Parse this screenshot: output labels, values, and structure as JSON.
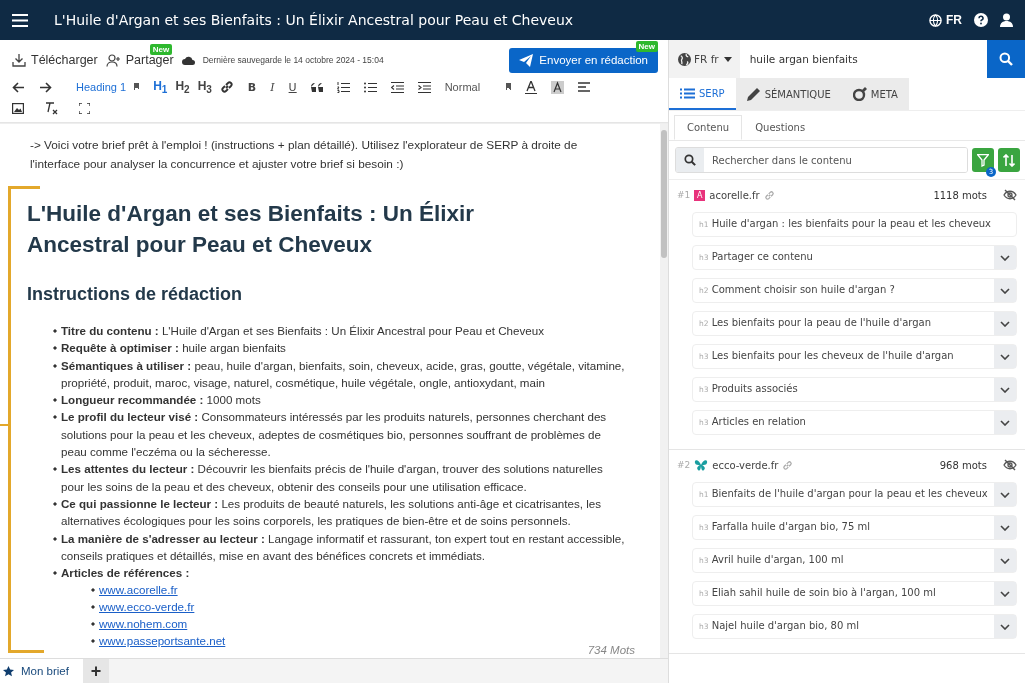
{
  "header": {
    "title": "L'Huile d'Argan et ses Bienfaits : Un Élixir Ancestral pour Peau et Cheveux",
    "language": "FR"
  },
  "actions": {
    "download": "Télécharger",
    "share": "Partager",
    "share_badge": "New",
    "saved": "Dernière sauvegarde le 14 octobre 2024 - 15:04",
    "send": "Envoyer en rédaction",
    "send_badge": "New"
  },
  "toolbar": {
    "heading_select": "Heading 1",
    "headings": [
      {
        "label": "H$_{1}$",
        "selected": true
      },
      {
        "label": "H$_{2}$",
        "selected": false
      },
      {
        "label": "H$_{3}$",
        "selected": false
      }
    ],
    "formats": [
      "B",
      "I",
      "U"
    ],
    "size_select": "Normal"
  },
  "brief": {
    "intro": "-> Voici votre brief prêt à l'emploi ! (instructions + plan détaillé). Utilisez l'explorateur de SERP à droite de l'interface pour analyser la concurrence et ajuster votre brief si besoin :)",
    "title": "L'Huile d'Argan et ses Bienfaits : Un Élixir Ancestral pour Peau et Cheveux",
    "subtitle": "Instructions de rédaction",
    "items": [
      {
        "label": "Titre du contenu :",
        "text": "L'Huile d'Argan et ses Bienfaits : Un Élixir Ancestral pour Peau et Cheveux"
      },
      {
        "label": "Requête à optimiser :",
        "text": "huile argan bienfaits"
      },
      {
        "label": "Sémantiques à utiliser :",
        "text": "peau, huile d'argan, bienfaits, soin, cheveux, acide, gras, goutte, végétale, vitamine, propriété, produit, maroc, visage, naturel, cosmétique, huile végétale, ongle, antioxydant, main"
      },
      {
        "label": "Longueur recommandée :",
        "text": "1000 mots"
      },
      {
        "label": "Le profil du lecteur visé :",
        "text": "Consommateurs intéressés par les produits naturels, personnes cherchant des solutions pour la peau et les cheveux, adeptes de cosmétiques bio, personnes souffrant de problèmes de peau comme l'eczéma ou la sécheresse."
      },
      {
        "label": "Les attentes du lecteur :",
        "text": "Découvrir les bienfaits précis de l'huile d'argan, trouver des solutions naturelles pour les soins de la peau et des cheveux, obtenir des conseils pour une utilisation efficace."
      },
      {
        "label": "Ce qui passionne le lecteur :",
        "text": "Les produits de beauté naturels, les solutions anti-âge et cicatrisantes, les alternatives écologiques pour les soins corporels, les pratiques de bien-être et de soins personnels."
      },
      {
        "label": "La manière de s'adresser au lecteur :",
        "text": "Langage informatif et rassurant, ton expert tout en restant accessible, conseils pratiques et détaillés, mise en avant des bénéfices concrets et immédiats."
      },
      {
        "label": "Articles de références :"
      }
    ],
    "references": [
      "www.acorelle.fr",
      "www.ecco-verde.fr",
      "www.nohem.com",
      "www.passeportsante.net"
    ],
    "word_count": "734 Mots"
  },
  "doc_tabs": [
    {
      "label": "Mon brief",
      "selected": true
    }
  ],
  "add_tab": "+",
  "serp": {
    "locale": "FR fr",
    "query": "huile argan bienfaits",
    "tabs": [
      {
        "label": "SERP",
        "selected": true
      },
      {
        "label": "SÉMANTIQUE",
        "selected": false
      },
      {
        "label": "META",
        "selected": false
      }
    ],
    "subtabs": [
      {
        "label": "Contenu",
        "selected": true
      },
      {
        "label": "Questions",
        "selected": false
      }
    ],
    "search_placeholder": "Rechercher dans le contenu",
    "filter_count": "3",
    "results": [
      {
        "rank": "#1",
        "favicon": {
          "kind": "letter",
          "text": "A"
        },
        "domain": "acorelle.fr",
        "words": "1118 mots",
        "headings": [
          {
            "level": "h1",
            "text": "Huile d'argan : les bienfaits pour la peau et les cheveux",
            "expandable": false
          },
          {
            "level": "h3",
            "text": "Partager ce contenu",
            "expandable": true
          },
          {
            "level": "h2",
            "text": "Comment choisir son huile d'argan ?",
            "expandable": true
          },
          {
            "level": "h2",
            "text": "Les bienfaits pour la peau de l'huile d'argan",
            "expandable": true
          },
          {
            "level": "h3",
            "text": "Les bienfaits pour les cheveux de l'huile d'argan",
            "expandable": true
          },
          {
            "level": "h3",
            "text": "Produits associés",
            "expandable": true
          },
          {
            "level": "h3",
            "text": "Articles en relation",
            "expandable": true
          }
        ]
      },
      {
        "rank": "#2",
        "favicon": {
          "kind": "butterfly"
        },
        "domain": "ecco-verde.fr",
        "words": "968 mots",
        "headings": [
          {
            "level": "h1",
            "text": "Bienfaits de l'huile d'argan pour la peau et les cheveux",
            "expandable": true
          },
          {
            "level": "h3",
            "text": "Farfalla huile d'argan bio, 75 ml",
            "expandable": true
          },
          {
            "level": "h3",
            "text": "Avril huile d'argan, 100 ml",
            "expandable": true
          },
          {
            "level": "h3",
            "text": "Eliah sahil huile de soin bio à l'argan, 100 ml",
            "expandable": true
          },
          {
            "level": "h3",
            "text": "Najel huile d'argan bio, 80 ml",
            "expandable": true
          }
        ]
      }
    ]
  }
}
